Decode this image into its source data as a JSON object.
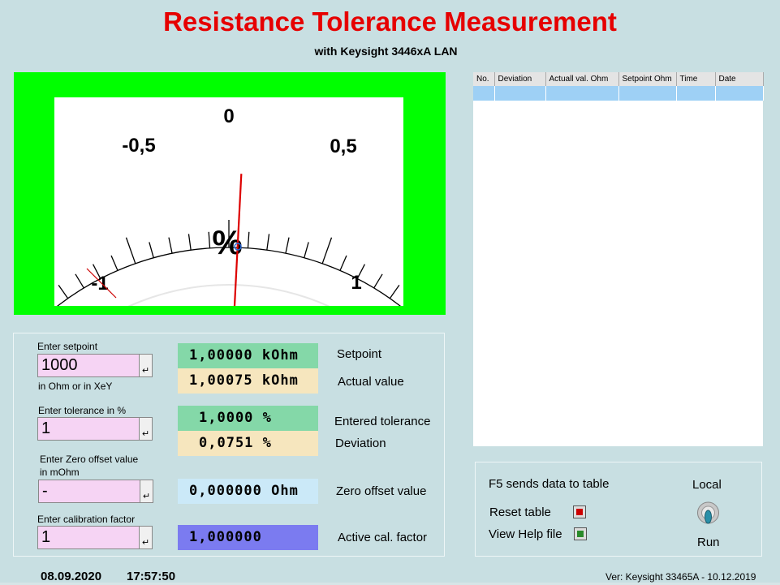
{
  "header": {
    "title": "Resistance Tolerance Measurement",
    "subtitle": "with Keysight 3446xA LAN"
  },
  "meter": {
    "labels": {
      "zero": "0",
      "neg_half": "-0,5",
      "pos_half": "0,5",
      "neg_one": "-1",
      "pos_one": "1",
      "unit": "%"
    },
    "range": [
      -1,
      1
    ],
    "needle_value": 0.0751,
    "colors": {
      "frame": "#00ff00",
      "needle": "#dd0000"
    }
  },
  "inputs": {
    "setpoint": {
      "label": "Enter setpoint",
      "value": "1000",
      "hint": "in Ohm or in XeY"
    },
    "tolerance": {
      "label": "Enter tolerance in %",
      "value": "1"
    },
    "zero_offset": {
      "label_line1": "Enter Zero offset value",
      "label_line2": "in mOhm",
      "value": "-"
    },
    "cal_factor": {
      "label": "Enter calibration factor",
      "value": "1"
    },
    "enter_glyph": "↵"
  },
  "readouts": {
    "setpoint": {
      "value": "1,00000  kOhm",
      "label": "Setpoint",
      "color": "#84d8a8"
    },
    "actual": {
      "value": "1,00075  kOhm",
      "label": "Actual value",
      "color": "#f6e6be"
    },
    "tolerance": {
      "value": "1,0000  %",
      "label": "Entered tolerance",
      "color": "#84d8a8"
    },
    "deviation": {
      "value": "0,0751  %",
      "label": "Deviation",
      "color": "#f6e6be"
    },
    "zero_offset": {
      "value": "0,000000  Ohm",
      "label": "Zero offset value",
      "color": "#cbe9f8"
    },
    "cal_factor": {
      "value": "1,000000",
      "label": "Active cal. factor",
      "color": "#7b7bf0"
    }
  },
  "table": {
    "columns": [
      "No.",
      "Deviation",
      "Actuall val. Ohm",
      "Setpoint Ohm",
      "Time",
      "Date"
    ],
    "selected_row_color": "#9ed0f5"
  },
  "controls": {
    "f5_text": "F5 sends data to table",
    "reset_label": "Reset table",
    "help_label": "View Help file",
    "local_label": "Local",
    "run_label": "Run",
    "reset_icon_color": "#cc0000",
    "help_icon_color": "#2a8a2a"
  },
  "status": {
    "date": "08.09.2020",
    "time": "17:57:50",
    "version": "Ver: Keysight 33465A - 10.12.2019"
  }
}
